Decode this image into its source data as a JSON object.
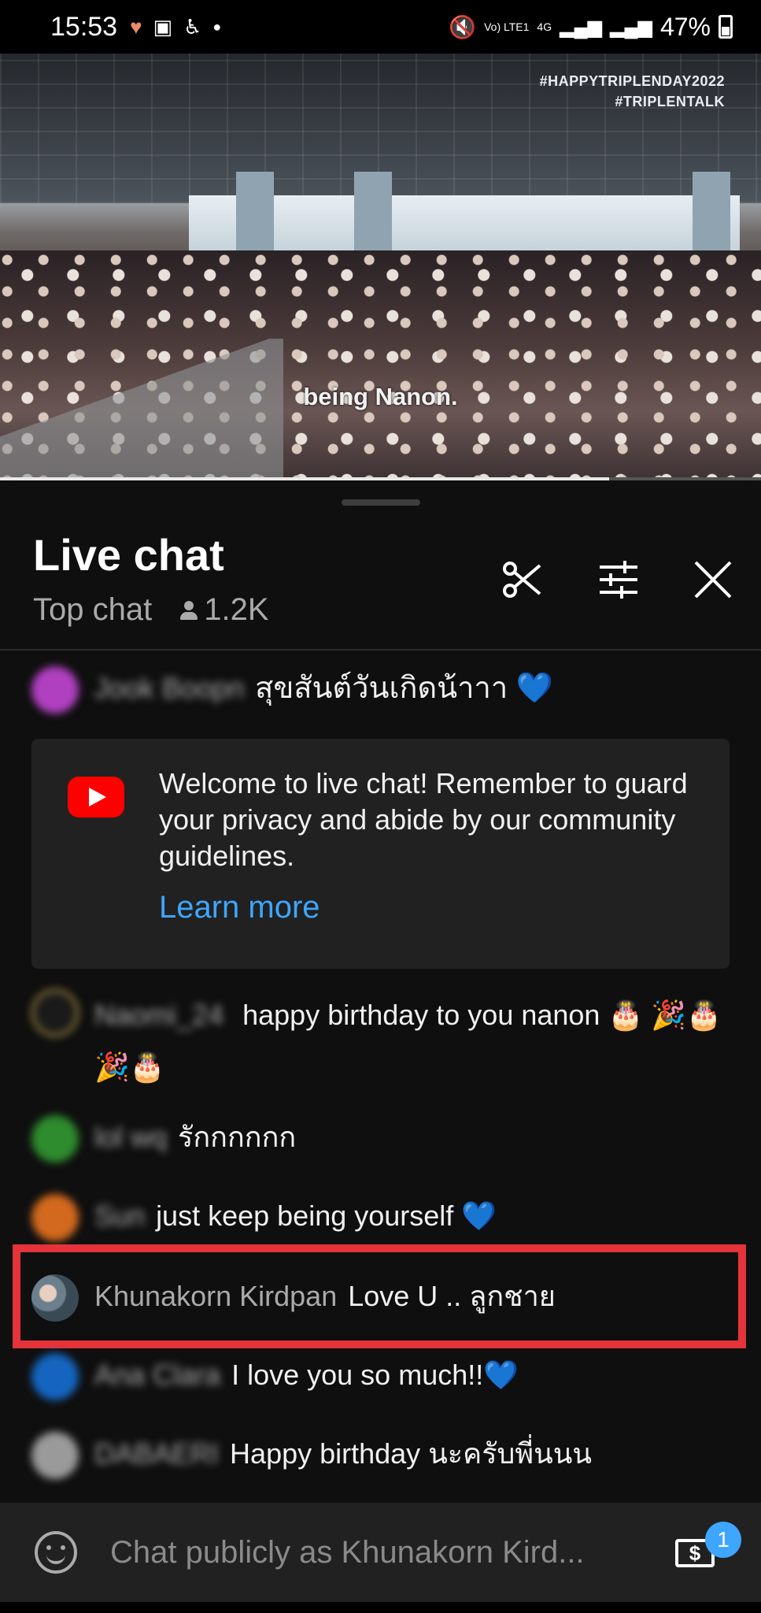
{
  "status_bar": {
    "time": "15:53",
    "battery": "47%",
    "network": "4G",
    "volte": "Vo) LTE1",
    "left_icons": [
      "heart-rate-icon",
      "gallery-icon",
      "accessibility-icon",
      "dot-icon"
    ],
    "right_icons": [
      "mute-icon",
      "signal-icon",
      "signal-icon",
      "battery-icon"
    ]
  },
  "video": {
    "hashtags": [
      "#HAPPYTRIPLENDAY2022",
      "#TRIPLENTALK"
    ],
    "subtitle": "being Nanon.",
    "progress": 0.8
  },
  "header": {
    "title": "Live chat",
    "mode": "Top chat",
    "viewers": "1.2K"
  },
  "welcome": {
    "message": "Welcome to live chat! Remember to guard your privacy and abide by our community guidelines.",
    "link": "Learn more"
  },
  "messages": [
    {
      "author": "Jook Boopn",
      "text": "สุขสันต์วันเกิดน้าาา 💙",
      "avatar_color": "#b040c0",
      "blurred": true
    },
    {
      "author": "Naomi_24",
      "text": "happy birthday to you nanon 🎂 🎉🎂🎉🎂",
      "avatar_color": "#1a1a1a",
      "blurred": true
    },
    {
      "author": "lol wq",
      "text": "รักกกกกก",
      "avatar_color": "#2e8b2e",
      "blurred": true
    },
    {
      "author": "Sun",
      "text": "just keep being yourself 💙",
      "avatar_color": "#d2691e",
      "blurred": true
    },
    {
      "author": "Khunakorn Kirdpan",
      "text": "Love U .. ลูกชาย",
      "avatar_color": "#6b7f8c",
      "blurred": false
    },
    {
      "author": "Ana Clara",
      "text": "I love you so much!!💙",
      "avatar_color": "#1565c0",
      "blurred": true
    },
    {
      "author": "DABAERI",
      "text": "Happy birthday นะครับพี่นนน",
      "avatar_color": "#9a9a9a",
      "blurred": true
    }
  ],
  "input": {
    "placeholder": "Chat publicly as Khunakorn Kird..."
  },
  "superchat_badge": "1",
  "colors": {
    "accent_blue": "#3ea6ff",
    "youtube_red": "#ff0000",
    "highlight_red": "#e5333a"
  }
}
